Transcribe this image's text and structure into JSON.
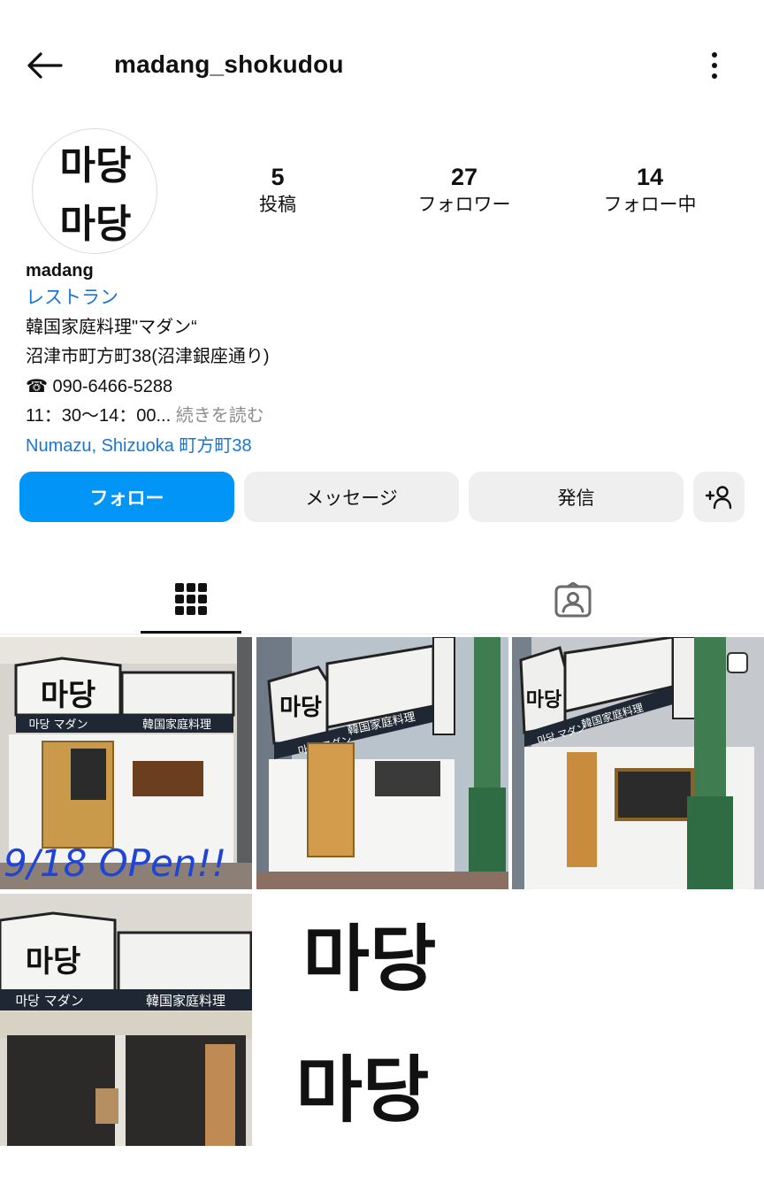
{
  "header": {
    "username": "madang_shokudou"
  },
  "stats": [
    {
      "value": "5",
      "label": "投稿"
    },
    {
      "value": "27",
      "label": "フォロワー"
    },
    {
      "value": "14",
      "label": "フォロー中"
    }
  ],
  "bio": {
    "name": "madang",
    "category": "レストラン",
    "lines": [
      "韓国家庭料理\"マダン“",
      "沼津市町方町38(沼津銀座通り)",
      "☎ 090-6466-5288"
    ],
    "hours": "11：30〜14：00...",
    "more": " 続きを読む",
    "location": "Numazu, Shizuoka 町方町38"
  },
  "buttons": {
    "follow": "フォロー",
    "message": "メッセージ",
    "call": "発信"
  },
  "avatar_text": [
    "마당",
    "마당"
  ],
  "posts": [
    {
      "sign_logo": "마당",
      "sign_sub": "마당 マダン",
      "sign_right": "韓国家庭料理",
      "overlay": "9/18 OPen!!"
    },
    {
      "sign_logo": "마당",
      "sign_sub": "마당 マダン",
      "sign_right": "韓国家庭料理"
    },
    {
      "sign_logo": "마당",
      "sign_sub": "마당 マダン",
      "sign_right": "韓国家庭料理"
    },
    {
      "sign_logo": "마당",
      "sign_sub": "마당 マダン",
      "sign_right": "韓国家庭料理"
    },
    {
      "text": [
        "마당",
        "마당"
      ]
    }
  ],
  "colors": {
    "accent": "#0095f6",
    "link": "#1877d4",
    "button_gray": "#efefef"
  }
}
